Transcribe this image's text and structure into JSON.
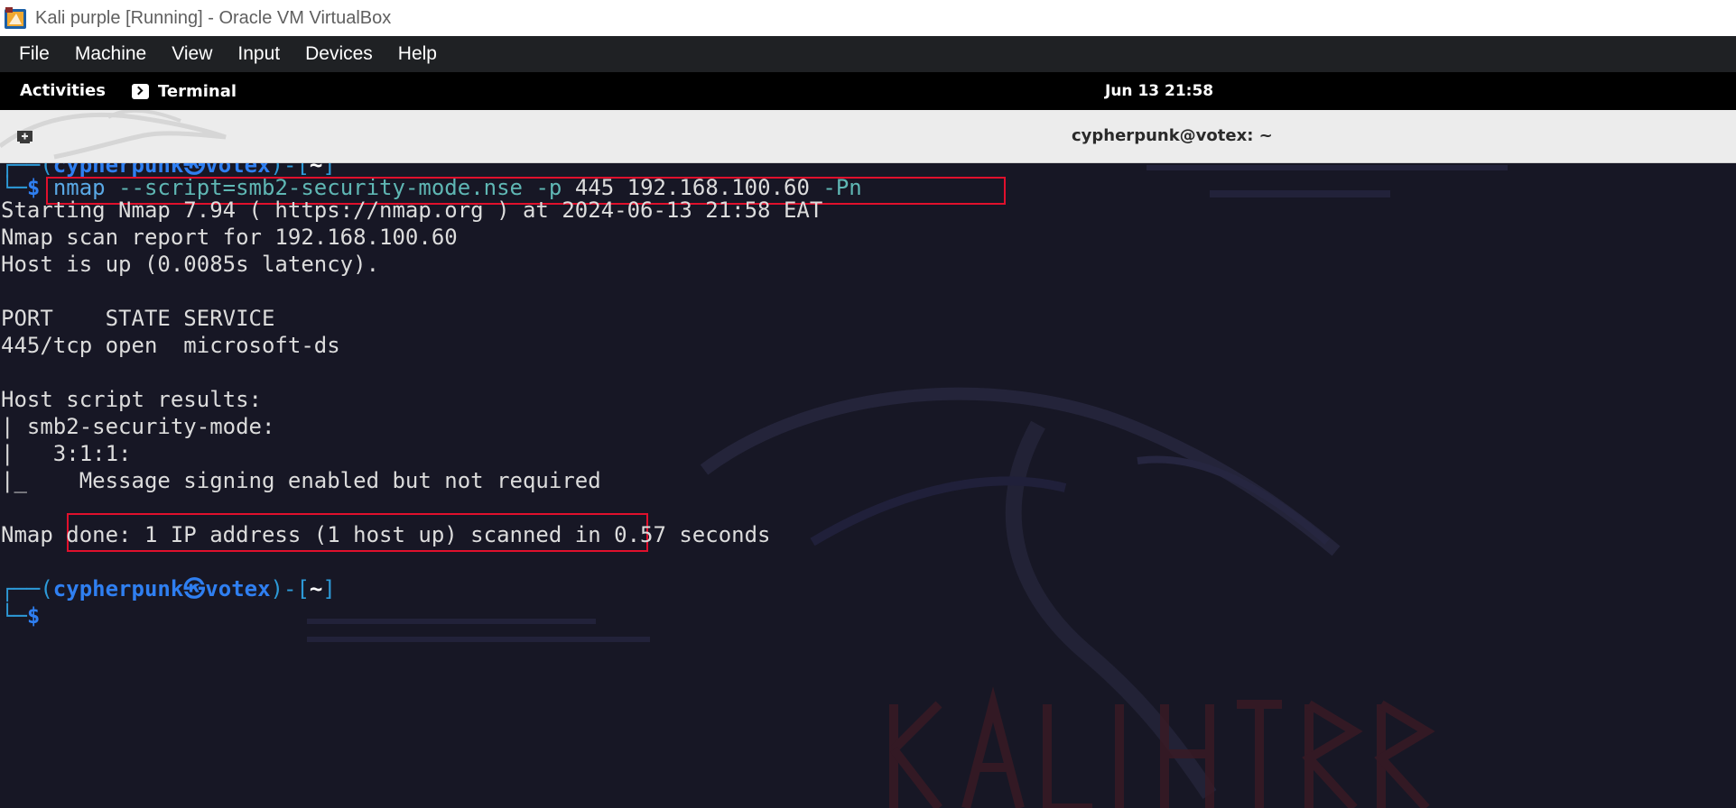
{
  "window": {
    "title": "Kali purple [Running] - Oracle VM VirtualBox",
    "icon": "virtualbox-icon"
  },
  "menu": {
    "items": [
      "File",
      "Machine",
      "View",
      "Input",
      "Devices",
      "Help"
    ]
  },
  "topbar": {
    "activities": "Activities",
    "app_name": "Terminal",
    "app_icon": "terminal-icon",
    "clock": "Jun 13  21:58"
  },
  "terminal": {
    "title": "cypherpunk@votex: ~",
    "new_tab_icon": "new-tab-icon",
    "prompt1": {
      "frame_top": "┌──(",
      "user": "cypherpunk",
      "at": "㉿",
      "host": "votex",
      "mid": ")-[",
      "dir": "~",
      "end": "]",
      "frame_bottom": "└─",
      "dollar": "$"
    },
    "command": {
      "program": "nmap",
      "script_arg": "--script=smb2-security-mode.nse",
      "port_flag": "-p",
      "port": "445",
      "ip": "192.168.100.60",
      "pn_flag": "-Pn"
    },
    "output": [
      "Starting Nmap 7.94 ( https://nmap.org ) at 2024-06-13 21:58 EAT",
      "Nmap scan report for 192.168.100.60",
      "Host is up (0.0085s latency).",
      "",
      "PORT    STATE SERVICE",
      "445/tcp open  microsoft-ds",
      "",
      "Host script results:",
      "| smb2-security-mode:",
      "|   3:1:1:",
      "|_    Message signing enabled but not required",
      "",
      "Nmap done: 1 IP address (1 host up) scanned in 0.57 seconds"
    ],
    "prompt2": {
      "frame_top": "┌──(",
      "user": "cypherpunk",
      "at": "㉿",
      "host": "votex",
      "mid": ")-[",
      "dir": "~",
      "end": "]",
      "frame_bottom": "└─",
      "dollar": "$"
    },
    "highlight_color": "#e0102c"
  },
  "colors": {
    "terminal_bg": "#171725",
    "prompt_blue": "#2f7ff1",
    "frame_cyan": "#2d9ad8"
  }
}
